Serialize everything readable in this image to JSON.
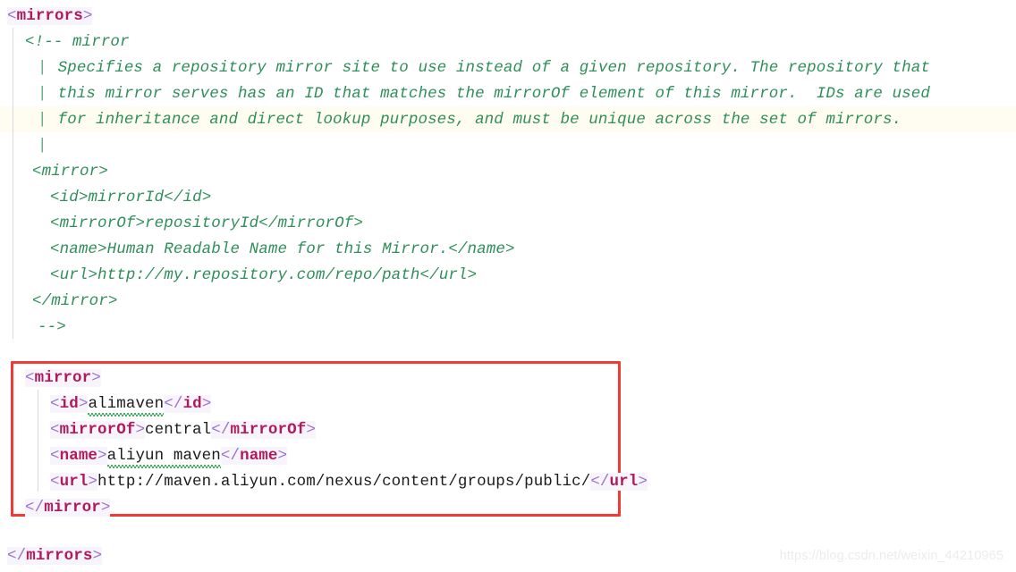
{
  "editor": {
    "language": "xml",
    "file_section": "mirrors",
    "colors": {
      "background": "#ffffff",
      "tag_name": "#b01a5b",
      "angle_bracket": "#9b72cf",
      "text_content": "#1c1c1c",
      "comment": "#2f8f59",
      "token_background": "#f7f4fc",
      "line_highlight": "#fffdf2",
      "indent_guide": "#d8d8dd",
      "annotation_box": "#ef3b33",
      "spellcheck_underline": "#2f9e4f",
      "watermark": "#ececec"
    }
  },
  "code": {
    "root_open": {
      "lt": "<",
      "name": "mirrors",
      "gt": ">"
    },
    "root_close": {
      "lt": "</",
      "name": "mirrors",
      "gt": ">"
    },
    "comment": {
      "open": "<!-- mirror",
      "bar": "|",
      "lines": [
        "Specifies a repository mirror site to use instead of a given repository. The repository that",
        "this mirror serves has an ID that matches the mirrorOf element of this mirror.  IDs are used",
        "for inheritance and direct lookup purposes, and must be unique across the set of mirrors.",
        ""
      ],
      "sample": {
        "open_tag": "<mirror>",
        "close_tag": "</mirror>",
        "entries": [
          {
            "tag": "id",
            "value": "mirrorId"
          },
          {
            "tag": "mirrorOf",
            "value": "repositoryId"
          },
          {
            "tag": "name",
            "value": "Human Readable Name for this Mirror."
          },
          {
            "tag": "url",
            "value": "http://my.repository.com/repo/path"
          }
        ]
      },
      "close": "-->"
    },
    "active_mirror": {
      "open_tag_name": "mirror",
      "close_tag_name": "mirror",
      "entries": [
        {
          "tag": "id",
          "value": "alimaven",
          "misspelled": true
        },
        {
          "tag": "mirrorOf",
          "value": "central",
          "misspelled": false
        },
        {
          "tag": "name",
          "value": "aliyun maven",
          "misspelled": true
        },
        {
          "tag": "url",
          "value": "http://maven.aliyun.com/nexus/content/groups/public/",
          "misspelled": false
        }
      ]
    }
  },
  "annotation": {
    "type": "rectangle-highlight",
    "color": "#ef3b33",
    "target": "active mirror block"
  },
  "watermark": {
    "text": "https://blog.csdn.net/weixin_44210965"
  }
}
